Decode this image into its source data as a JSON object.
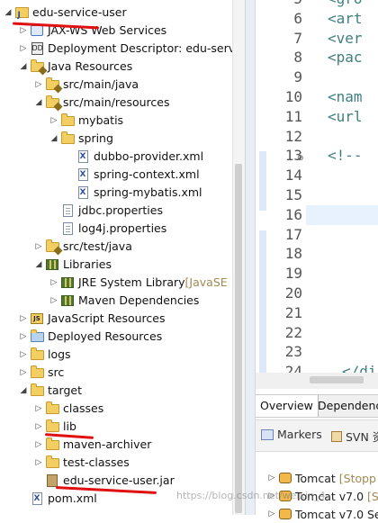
{
  "explorer": {
    "items": [
      {
        "label": "edu-service-user",
        "deco": "",
        "icon": "project-icon",
        "twisty": "expanded"
      },
      {
        "label": "JAX-WS Web Services",
        "deco": "",
        "icon": "web-services-icon",
        "twisty": "collapsed"
      },
      {
        "label": "Deployment Descriptor: edu-serv",
        "deco": "",
        "icon": "deployment-descriptor-icon",
        "twisty": "collapsed"
      },
      {
        "label": "Java Resources",
        "deco": "",
        "icon": "java-resources-icon",
        "twisty": "expanded"
      },
      {
        "label": "src/main/java",
        "deco": "",
        "icon": "source-folder-icon",
        "twisty": "collapsed"
      },
      {
        "label": "src/main/resources",
        "deco": "",
        "icon": "source-folder-icon",
        "twisty": "expanded"
      },
      {
        "label": "mybatis",
        "deco": "",
        "icon": "folder-icon",
        "twisty": "collapsed"
      },
      {
        "label": "spring",
        "deco": "",
        "icon": "folder-icon",
        "twisty": "expanded"
      },
      {
        "label": "dubbo-provider.xml",
        "deco": "",
        "icon": "xml-file-icon",
        "twisty": "none"
      },
      {
        "label": "spring-context.xml",
        "deco": "",
        "icon": "xml-file-icon",
        "twisty": "none"
      },
      {
        "label": "spring-mybatis.xml",
        "deco": "",
        "icon": "xml-file-icon",
        "twisty": "none"
      },
      {
        "label": "jdbc.properties",
        "deco": "",
        "icon": "properties-file-icon",
        "twisty": "none"
      },
      {
        "label": "log4j.properties",
        "deco": "",
        "icon": "properties-file-icon",
        "twisty": "none"
      },
      {
        "label": "src/test/java",
        "deco": "",
        "icon": "source-folder-icon",
        "twisty": "collapsed"
      },
      {
        "label": "Libraries",
        "deco": "",
        "icon": "library-icon",
        "twisty": "expanded"
      },
      {
        "label": "JRE System Library",
        "deco": "[JavaSE",
        "icon": "library-icon",
        "twisty": "collapsed"
      },
      {
        "label": "Maven Dependencies",
        "deco": "",
        "icon": "library-icon",
        "twisty": "collapsed"
      },
      {
        "label": "JavaScript Resources",
        "deco": "",
        "icon": "javascript-resources-icon",
        "twisty": "collapsed"
      },
      {
        "label": "Deployed Resources",
        "deco": "",
        "icon": "deployed-resources-icon",
        "twisty": "collapsed"
      },
      {
        "label": "logs",
        "deco": "",
        "icon": "folder-icon",
        "twisty": "collapsed"
      },
      {
        "label": "src",
        "deco": "",
        "icon": "folder-icon",
        "twisty": "collapsed"
      },
      {
        "label": "target",
        "deco": "",
        "icon": "folder-icon",
        "twisty": "expanded"
      },
      {
        "label": "classes",
        "deco": "",
        "icon": "folder-icon",
        "twisty": "collapsed"
      },
      {
        "label": "lib",
        "deco": "",
        "icon": "folder-icon",
        "twisty": "collapsed"
      },
      {
        "label": "maven-archiver",
        "deco": "",
        "icon": "folder-icon",
        "twisty": "collapsed"
      },
      {
        "label": "test-classes",
        "deco": "",
        "icon": "folder-icon",
        "twisty": "collapsed"
      },
      {
        "label": "edu-service-user.jar",
        "deco": "",
        "icon": "jar-file-icon",
        "twisty": "none"
      },
      {
        "label": "pom.xml",
        "deco": "",
        "icon": "xml-file-icon",
        "twisty": "none"
      }
    ]
  },
  "editor": {
    "line_numbers": [
      "5",
      "6",
      "7",
      "8",
      "9",
      "10",
      "11",
      "12",
      "13",
      "14",
      "15",
      "16",
      "17",
      "18",
      "19",
      "20",
      "21",
      "22",
      "23",
      "24"
    ],
    "code_lines": [
      {
        "line": "5",
        "text": "<gro"
      },
      {
        "line": "6",
        "text": "<art"
      },
      {
        "line": "7",
        "text": "<ver"
      },
      {
        "line": "8",
        "text": "<pac"
      },
      {
        "line": "10",
        "text": "<nam"
      },
      {
        "line": "11",
        "text": "<url"
      },
      {
        "line": "13",
        "text": "<!--"
      },
      {
        "line": "24",
        "text": "</di"
      }
    ]
  },
  "editor_tabs": [
    "Overview",
    "Dependencie"
  ],
  "views": {
    "tabs": [
      "Markers",
      "SVN 资"
    ],
    "servers": [
      {
        "name": "Tomcat",
        "status": "[Stopp"
      },
      {
        "name": "Tomcat v7.0",
        "status": "[St"
      },
      {
        "name": "Tomcat v7.0 Ser",
        "status": ""
      }
    ]
  },
  "watermark": "https://blog.csdn.net/weixin_4...",
  "colors": {
    "annotation_red": "#e01010",
    "decoration": "#a08a53",
    "code_teal": "#3f7f7f"
  }
}
